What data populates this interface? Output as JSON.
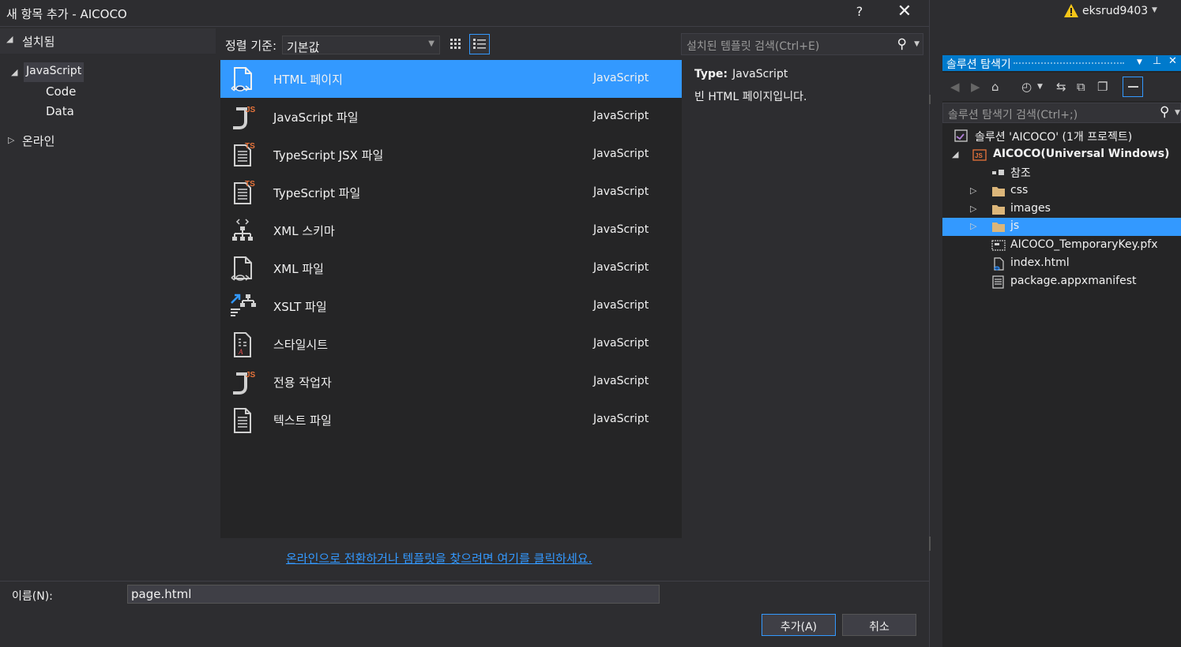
{
  "dialog": {
    "title": "새 항목 추가 - AICOCO",
    "help": "?",
    "close": "✕"
  },
  "left_tree": {
    "installed": "설치됨",
    "javascript": "JavaScript",
    "code": "Code",
    "data": "Data",
    "online": "온라인"
  },
  "sort": {
    "label": "정렬 기준:",
    "value": "기본값"
  },
  "search": {
    "placeholder": "설치된 템플릿 검색(Ctrl+E)"
  },
  "templates": [
    {
      "name": "HTML 페이지",
      "type": "JavaScript",
      "icon": "html-page-icon"
    },
    {
      "name": "JavaScript 파일",
      "type": "JavaScript",
      "icon": "js-file-icon"
    },
    {
      "name": "TypeScript JSX 파일",
      "type": "JavaScript",
      "icon": "ts-jsx-file-icon"
    },
    {
      "name": "TypeScript 파일",
      "type": "JavaScript",
      "icon": "ts-file-icon"
    },
    {
      "name": "XML 스키마",
      "type": "JavaScript",
      "icon": "xml-schema-icon"
    },
    {
      "name": "XML 파일",
      "type": "JavaScript",
      "icon": "xml-file-icon"
    },
    {
      "name": "XSLT 파일",
      "type": "JavaScript",
      "icon": "xslt-file-icon"
    },
    {
      "name": "스타일시트",
      "type": "JavaScript",
      "icon": "stylesheet-icon"
    },
    {
      "name": "전용 작업자",
      "type": "JavaScript",
      "icon": "dedicated-worker-icon"
    },
    {
      "name": "텍스트 파일",
      "type": "JavaScript",
      "icon": "text-file-icon"
    }
  ],
  "details": {
    "type_label": "Type:",
    "type_value": "JavaScript",
    "description": "빈 HTML 페이지입니다."
  },
  "online_link": "온라인으로 전환하거나 템플릿을 찾으려면 여기를 클릭하세요.",
  "name_field": {
    "label": "이름(N):",
    "value": "page.html"
  },
  "buttons": {
    "add": "추가(A)",
    "cancel": "취소"
  },
  "user": {
    "name": "eksrud9403"
  },
  "solution_explorer": {
    "title": "솔루션 탐색기",
    "search_placeholder": "솔루션 탐색기 검색(Ctrl+;)",
    "solution": "솔루션 'AICOCO' (1개 프로젝트)",
    "project": "AICOCO(Universal Windows)",
    "items": [
      {
        "label": "참조",
        "icon": "references-icon"
      },
      {
        "label": "css",
        "icon": "folder-icon"
      },
      {
        "label": "images",
        "icon": "folder-icon"
      },
      {
        "label": "js",
        "icon": "folder-icon"
      },
      {
        "label": "AICOCO_TemporaryKey.pfx",
        "icon": "certificate-icon"
      },
      {
        "label": "index.html",
        "icon": "html-file-icon"
      },
      {
        "label": "package.appxmanifest",
        "icon": "manifest-icon"
      }
    ]
  },
  "colors": {
    "selection": "#3399ff",
    "accent": "#007acc",
    "background": "#2d2d30",
    "list_bg": "#252526"
  }
}
